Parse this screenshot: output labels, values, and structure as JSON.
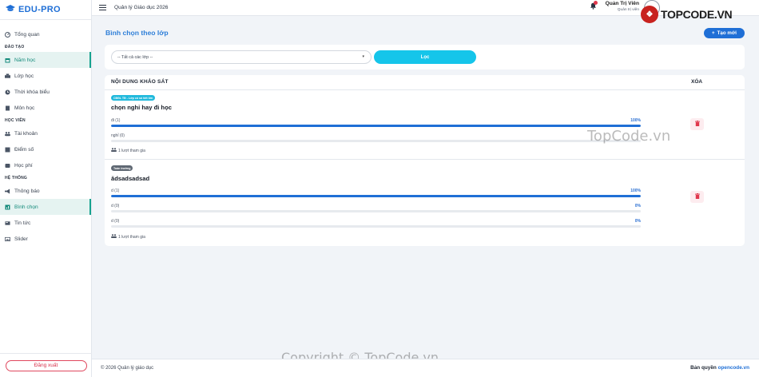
{
  "brand": {
    "name": "EDU-PRO",
    "icon": "graduation-cap-icon"
  },
  "sidebar": {
    "items": [
      {
        "label": "Tổng quan",
        "icon": "dashboard-icon"
      },
      {
        "section": "ĐÀO TẠO"
      },
      {
        "label": "Năm học",
        "icon": "calendar-icon",
        "active": true
      },
      {
        "label": "Lớp học",
        "icon": "class-icon"
      },
      {
        "label": "Thời khóa biểu",
        "icon": "clock-icon"
      },
      {
        "label": "Môn học",
        "icon": "book-icon"
      },
      {
        "section": "HỌC VIÊN"
      },
      {
        "label": "Tài khoản",
        "icon": "users-icon"
      },
      {
        "label": "Điểm số",
        "icon": "score-icon"
      },
      {
        "label": "Học phí",
        "icon": "money-icon"
      },
      {
        "section": "HỆ THỐNG"
      },
      {
        "label": "Thông báo",
        "icon": "megaphone-icon"
      },
      {
        "label": "Bình chọn",
        "icon": "poll-icon",
        "active": true
      },
      {
        "label": "Tin tức",
        "icon": "news-icon"
      },
      {
        "label": "Slider",
        "icon": "image-icon"
      }
    ],
    "logout_label": "Đăng xuất"
  },
  "topbar": {
    "title": "Quản lý Giáo dục 2026",
    "user_name": "Quản Trị Viên",
    "user_role": "Quản trị viên",
    "logo_text": "TOPCODE.VN"
  },
  "page": {
    "heading": "Bình chọn theo lớp",
    "create_label": "Tạo mới"
  },
  "filter": {
    "select_value": "-- Tất cả các lớp --",
    "button_label": "Lọc"
  },
  "table": {
    "col_content": "NỘI DUNG KHẢO SÁT",
    "col_delete": "XÓA",
    "rows": [
      {
        "badge": "CĐĐL TĐ - Lớp có số tiết lớn",
        "badge_color": "#21b9dc",
        "question": "chọn nghỉ hay đi học",
        "options": [
          {
            "label": "đi (1)",
            "pct": "100%",
            "fraction": 1.0
          },
          {
            "label": "nghỉ (0)",
            "pct": "",
            "fraction": 0.0
          }
        ],
        "participants": "1 lượt tham gia"
      },
      {
        "badge": "Toàn trường",
        "badge_color": "#5f6873",
        "question": "ădsadsadsad",
        "options": [
          {
            "label": "d (1)",
            "pct": "100%",
            "fraction": 1.0
          },
          {
            "label": "d (0)",
            "pct": "0%",
            "fraction": 0.0
          },
          {
            "label": "d (0)",
            "pct": "0%",
            "fraction": 0.0
          }
        ],
        "participants": "1 lượt tham gia"
      }
    ]
  },
  "footer": {
    "copyright": "© 2026 Quản lý giáo dục",
    "rights_prefix": "Bản quyền",
    "rights_link": "opencode.vn"
  },
  "watermarks": {
    "middle": "TopCode.vn",
    "bottom": "Copyright © TopCode.vn"
  },
  "colors": {
    "primary": "#1f6fd6",
    "accent": "#15c5ea",
    "active": "#138a7a",
    "danger": "#e0384d"
  }
}
